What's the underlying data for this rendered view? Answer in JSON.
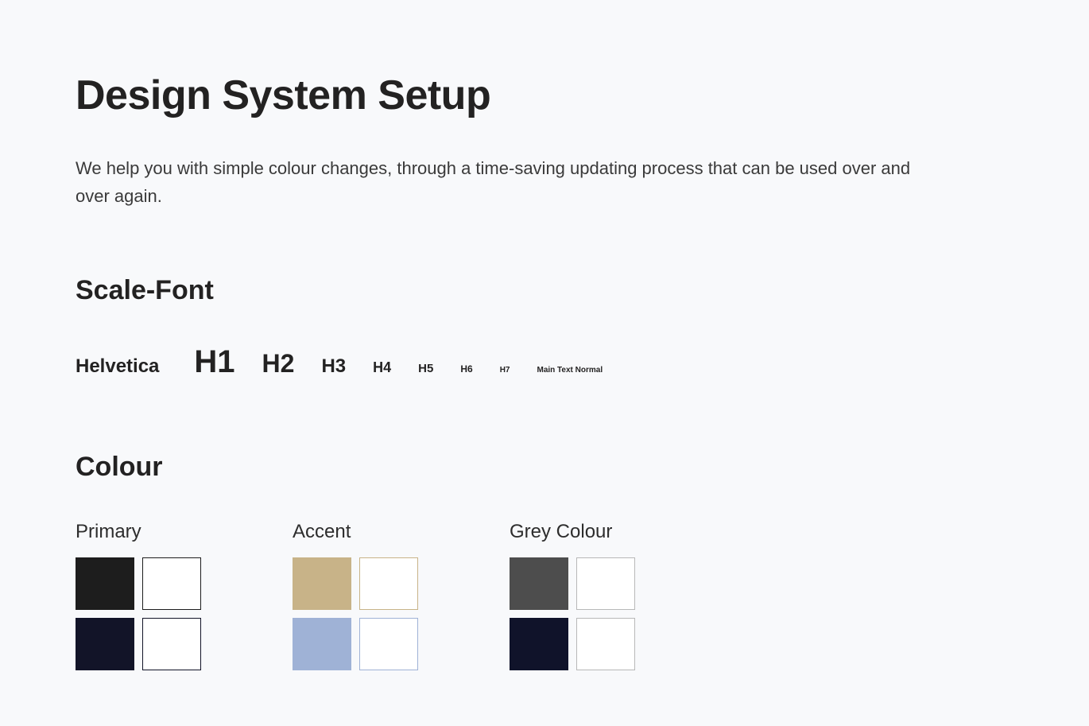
{
  "title": "Design System Setup",
  "subtitle": "We help you with simple colour changes, through a time-saving updating process that can be used over and over again.",
  "sections": {
    "scale_font": {
      "heading": "Scale-Font",
      "font_name": "Helvetica",
      "scale": {
        "h1": "H1",
        "h2": "H2",
        "h3": "H3",
        "h4": "H4",
        "h5": "H5",
        "h6": "H6",
        "h7": "H7",
        "main_text": "Main Text Normal"
      }
    },
    "colour": {
      "heading": "Colour",
      "groups": {
        "primary": {
          "label": "Primary",
          "swatches": [
            {
              "fill": "#1d1d1d",
              "border": "#1d1d1d"
            },
            {
              "fill": "#ffffff",
              "border": "#1d1d1d"
            },
            {
              "fill": "#121428",
              "border": "#121428"
            },
            {
              "fill": "#ffffff",
              "border": "#121428"
            }
          ]
        },
        "accent": {
          "label": "Accent",
          "swatches": [
            {
              "fill": "#c8b388",
              "border": "#c8b388"
            },
            {
              "fill": "#ffffff",
              "border": "#c8b388"
            },
            {
              "fill": "#9fb2d6",
              "border": "#9fb2d6"
            },
            {
              "fill": "#ffffff",
              "border": "#9fb2d6"
            }
          ]
        },
        "grey": {
          "label": "Grey Colour",
          "swatches": [
            {
              "fill": "#4d4d4d",
              "border": "#4d4d4d"
            },
            {
              "fill": "#ffffff",
              "border": "#b8b8b8"
            },
            {
              "fill": "#10132a",
              "border": "#10132a"
            },
            {
              "fill": "#ffffff",
              "border": "#b8b8b8"
            }
          ]
        }
      }
    }
  }
}
